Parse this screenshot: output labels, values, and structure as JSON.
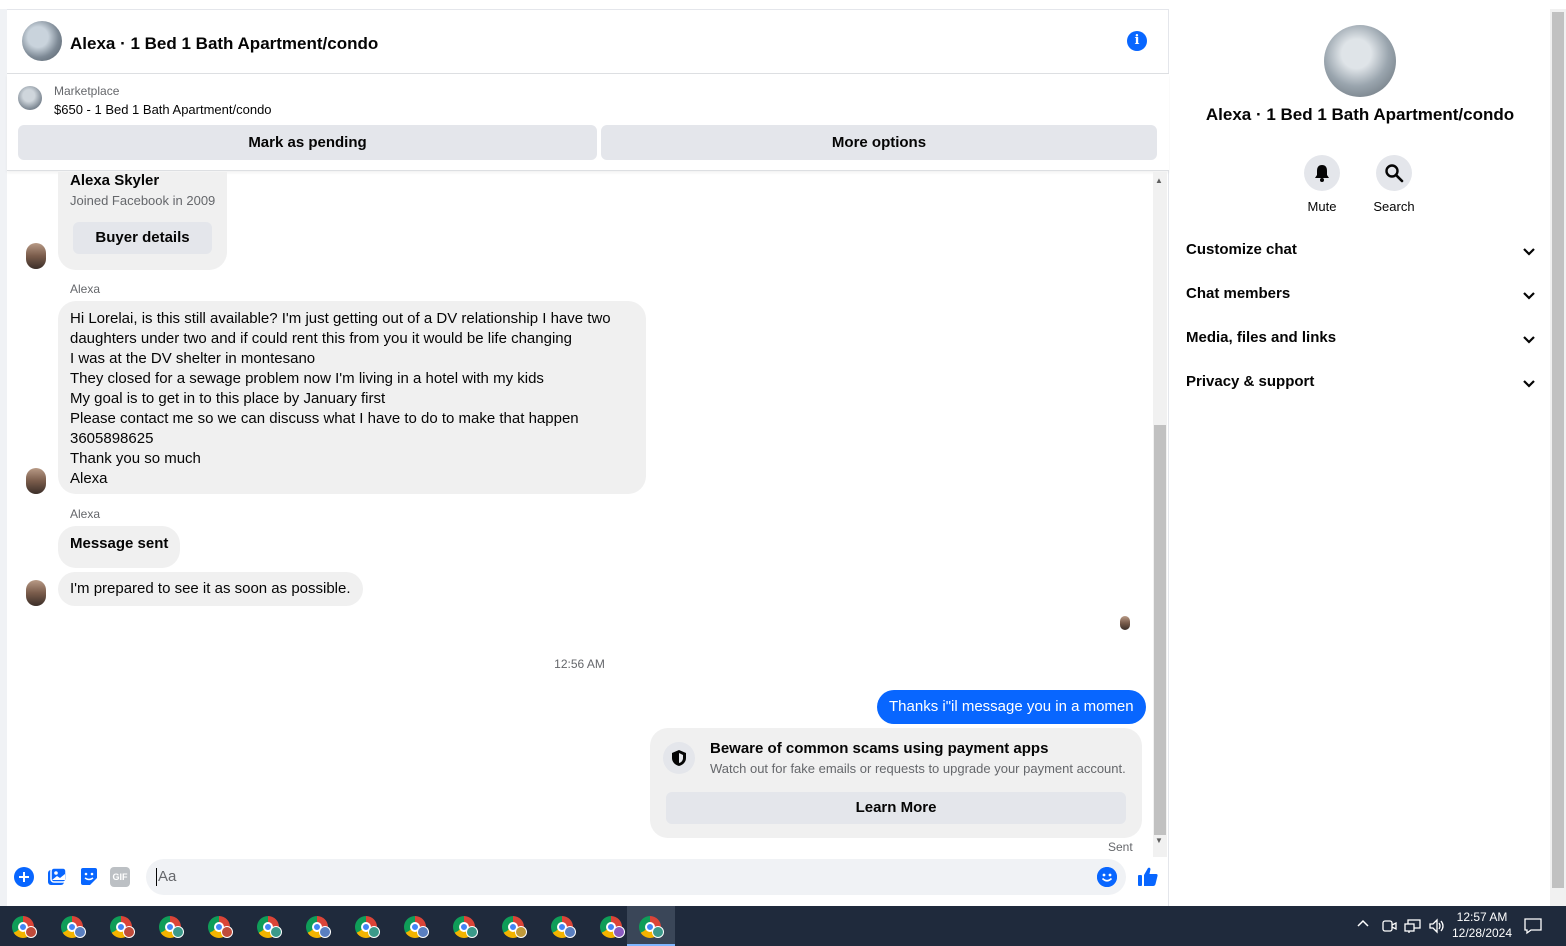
{
  "header": {
    "title": "Alexa · 1 Bed 1 Bath Apartment/condo",
    "info_icon": "i"
  },
  "marketplace": {
    "label": "Marketplace",
    "listing": "$650 - 1 Bed 1 Bath Apartment/condo",
    "pending_button": "Mark as pending",
    "more_button": "More options"
  },
  "buyer_card": {
    "name": "Alexa Skyler",
    "joined": "Joined Facebook in 2009",
    "details_button": "Buyer details"
  },
  "messages": {
    "sender1": "Alexa",
    "long_lines": [
      "Hi Lorelai, is this still available? I'm just getting out of a DV relationship I have two",
      "daughters under two and if could rent this from you it would be life changing",
      "I was at the DV shelter in montesano",
      "They closed for a sewage problem now I'm living in a hotel with my kids",
      "My goal is to get in to this place by January first",
      "Please contact me so we can discuss what I have to do to make that happen",
      "3605898625",
      "Thank you so much",
      "Alexa"
    ],
    "sender2": "Alexa",
    "message_sent": "Message sent",
    "prepared": "I'm prepared to see it as soon as possible.",
    "timestamp": "12:56 AM",
    "outgoing": "Thanks i\"il message you in a momen",
    "sent_status": "Sent"
  },
  "scam_notice": {
    "title": "Beware of common scams using payment apps",
    "desc": "Watch out for fake emails or requests to upgrade your payment account.",
    "button": "Learn More"
  },
  "composer": {
    "placeholder": "Aa",
    "gif_label": "GIF"
  },
  "right_panel": {
    "name": "Alexa · 1 Bed 1 Bath Apartment/condo",
    "mute": "Mute",
    "search": "Search",
    "sections": [
      "Customize chat",
      "Chat members",
      "Media, files and links",
      "Privacy & support"
    ]
  },
  "taskbar": {
    "time": "12:57 AM",
    "date": "12/28/2024"
  },
  "colors": {
    "accent": "#0866ff",
    "bubble_in": "#f0f0f0",
    "taskbar": "#1f2a3c"
  }
}
